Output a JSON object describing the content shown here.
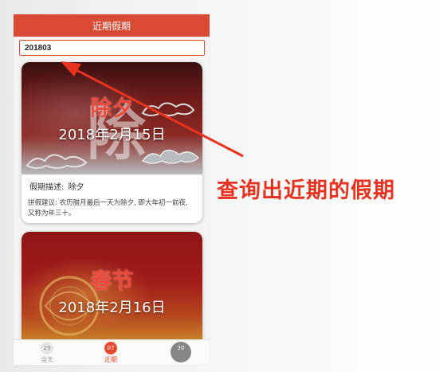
{
  "header": {
    "title": "近期假期"
  },
  "search": {
    "value": "201803"
  },
  "cards": [
    {
      "title": "除夕",
      "date": "2018年2月15日",
      "brush_glyph": "除",
      "desc_label": "假期描述:",
      "desc_value": "除夕",
      "tip": "拼假建议: 农历腊月最后一天为除夕, 即大年初一前夜, 又称为年三十。"
    },
    {
      "title": "春节",
      "date": "2018年2月16日"
    }
  ],
  "tabbar": {
    "tabs": [
      {
        "num": "29",
        "label": "当天"
      },
      {
        "num": "07",
        "label": "近期"
      },
      {
        "num": "30",
        "label": ""
      }
    ]
  },
  "annotation": {
    "text": "查询出近期的假期",
    "color": "#e8321f"
  },
  "colors": {
    "brand": "#d84a34",
    "active_tab": "#e94a2f"
  }
}
